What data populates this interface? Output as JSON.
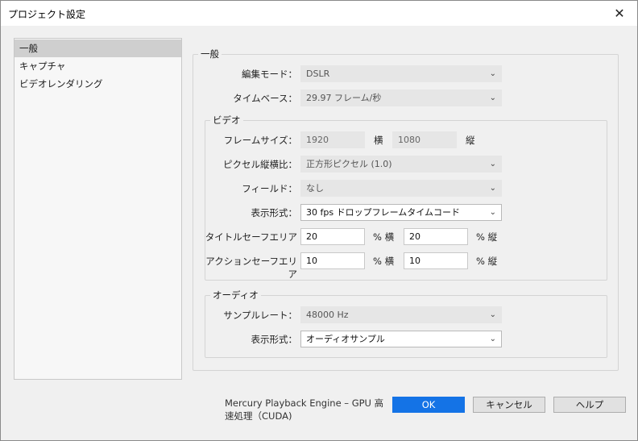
{
  "window": {
    "title": "プロジェクト設定",
    "close_glyph": "✕"
  },
  "sidebar": {
    "items": [
      {
        "label": "一般",
        "selected": true
      },
      {
        "label": "キャプチャ",
        "selected": false
      },
      {
        "label": "ビデオレンダリング",
        "selected": false
      }
    ]
  },
  "general": {
    "legend": "一般",
    "edit_mode": {
      "label": "編集モード：",
      "value": "DSLR"
    },
    "timebase": {
      "label": "タイムベース：",
      "value": "29.97 フレーム/秒"
    }
  },
  "video": {
    "legend": "ビデオ",
    "frame_size": {
      "label": "フレームサイズ：",
      "width": "1920",
      "width_unit": "横",
      "height": "1080",
      "height_unit": "縦"
    },
    "pixel_aspect": {
      "label": "ピクセル縦横比：",
      "value": "正方形ピクセル (1.0)"
    },
    "fields": {
      "label": "フィールド：",
      "value": "なし"
    },
    "display_format": {
      "label": "表示形式：",
      "value": "30 fps ドロップフレームタイムコード"
    },
    "title_safe": {
      "label": "タイトルセーフエリア",
      "h": "20",
      "h_unit": "% 横",
      "v": "20",
      "v_unit": "% 縦"
    },
    "action_safe": {
      "label": "アクションセーフエリア",
      "h": "10",
      "h_unit": "% 横",
      "v": "10",
      "v_unit": "% 縦"
    }
  },
  "audio": {
    "legend": "オーディオ",
    "sample_rate": {
      "label": "サンプルレート：",
      "value": "48000 Hz"
    },
    "display_format": {
      "label": "表示形式：",
      "value": "オーディオサンプル"
    }
  },
  "footer": {
    "status": "Mercury Playback Engine – GPU 高速処理（CUDA)",
    "ok": "OK",
    "cancel": "キャンセル",
    "help": "ヘルプ"
  },
  "icons": {
    "chevron": "chevron-down-icon",
    "close": "close-icon"
  },
  "colors": {
    "accent": "#1473e6",
    "selected_item": "#cfcfcf"
  }
}
